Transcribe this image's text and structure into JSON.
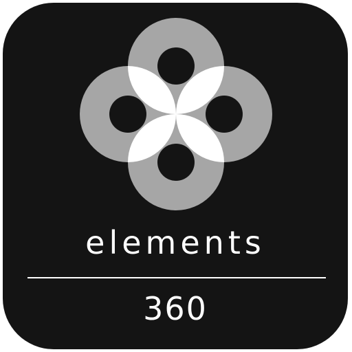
{
  "icon": {
    "brand_name": "elements",
    "brand_number": "360",
    "logo_icon": "four-ring-flower-icon",
    "colors": {
      "background": "#141414",
      "ring": "#a6a6a6",
      "overlap": "#ffffff",
      "text": "#ffffff"
    }
  }
}
